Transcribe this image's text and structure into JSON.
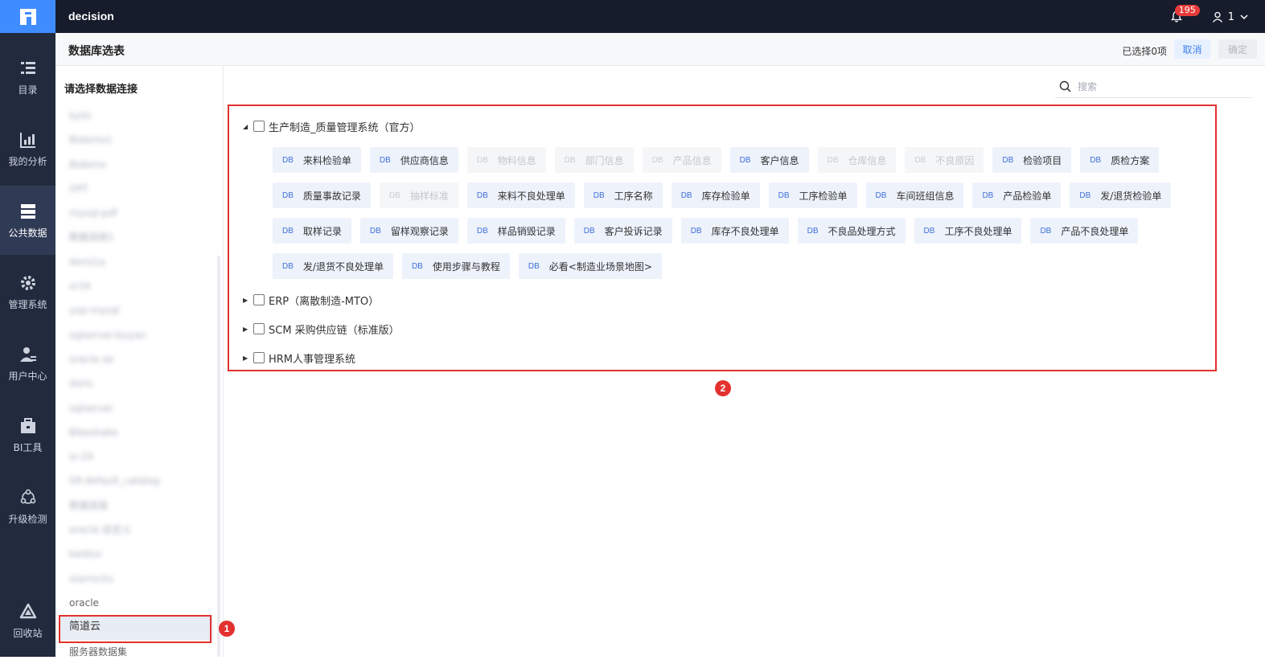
{
  "app": {
    "title": "decision",
    "notifications": "195",
    "user": "1"
  },
  "nav": [
    {
      "label": "目录",
      "icon": "catalog-icon"
    },
    {
      "label": "我的分析",
      "icon": "analysis-icon"
    },
    {
      "label": "公共数据",
      "icon": "public-data-icon",
      "active": true
    },
    {
      "label": "管理系统",
      "icon": "gear-icon"
    },
    {
      "label": "用户中心",
      "icon": "user-center-icon"
    },
    {
      "label": "BI工具",
      "icon": "toolbox-icon"
    },
    {
      "label": "升级检测",
      "icon": "upgrade-icon"
    },
    {
      "label": "回收站",
      "icon": "recycle-icon"
    }
  ],
  "header": {
    "title": "数据库选表",
    "selected_count": "已选择0项",
    "cancel": "取消",
    "ok": "确定"
  },
  "connections": {
    "heading": "请选择数据连接",
    "items": [
      "kylin",
      "BIdemo1",
      "BIdemo",
      "OPT",
      "mysql-pdf",
      "数据连接1",
      "doris1a",
      "sr34",
      "yop-mysql",
      "sqlserver-buyan",
      "oracle-xe",
      "doris",
      "sqlserver",
      "Bikeshake",
      "sr-24",
      "SR-default_catalog",
      "数据连接",
      "oracle-自定义",
      "kaiduo",
      "starrocks",
      "oracle",
      "简道云",
      "服务器数据集"
    ],
    "blurred_count": 20,
    "selected": "简道云"
  },
  "search": {
    "placeholder": "搜索"
  },
  "markers": {
    "m1": "1",
    "m2": "2"
  },
  "groups": [
    {
      "name": "生产制造_质量管理系统（官方）",
      "expanded": true
    },
    {
      "name": "ERP（离散制造-MTO）",
      "expanded": false
    },
    {
      "name": "SCM 采购供应链（标准版）",
      "expanded": false
    },
    {
      "name": "HRM人事管理系统",
      "expanded": false
    }
  ],
  "db_tag": "DB",
  "tables": [
    [
      {
        "name": "来料检验单"
      },
      {
        "name": "供应商信息"
      },
      {
        "name": "物料信息",
        "disabled": true
      },
      {
        "name": "部门信息",
        "disabled": true
      },
      {
        "name": "产品信息",
        "disabled": true
      },
      {
        "name": "客户信息"
      },
      {
        "name": "仓库信息",
        "disabled": true
      },
      {
        "name": "不良原因",
        "disabled": true
      },
      {
        "name": "检验项目"
      },
      {
        "name": "质检方案"
      }
    ],
    [
      {
        "name": "质量事故记录"
      },
      {
        "name": "抽样标准",
        "disabled": true
      },
      {
        "name": "来料不良处理单"
      },
      {
        "name": "工序名称"
      },
      {
        "name": "库存检验单"
      },
      {
        "name": "工序检验单"
      },
      {
        "name": "车间班组信息"
      },
      {
        "name": "产品检验单"
      },
      {
        "name": "发/退货检验单"
      }
    ],
    [
      {
        "name": "取样记录"
      },
      {
        "name": "留样观察记录"
      },
      {
        "name": "样品销毁记录"
      },
      {
        "name": "客户投诉记录"
      },
      {
        "name": "库存不良处理单"
      },
      {
        "name": "不良品处理方式"
      },
      {
        "name": "工序不良处理单"
      },
      {
        "name": "产品不良处理单"
      }
    ],
    [
      {
        "name": "发/退货不良处理单"
      },
      {
        "name": "使用步骤与教程"
      },
      {
        "name": "必看<制造业场景地图>"
      }
    ]
  ]
}
